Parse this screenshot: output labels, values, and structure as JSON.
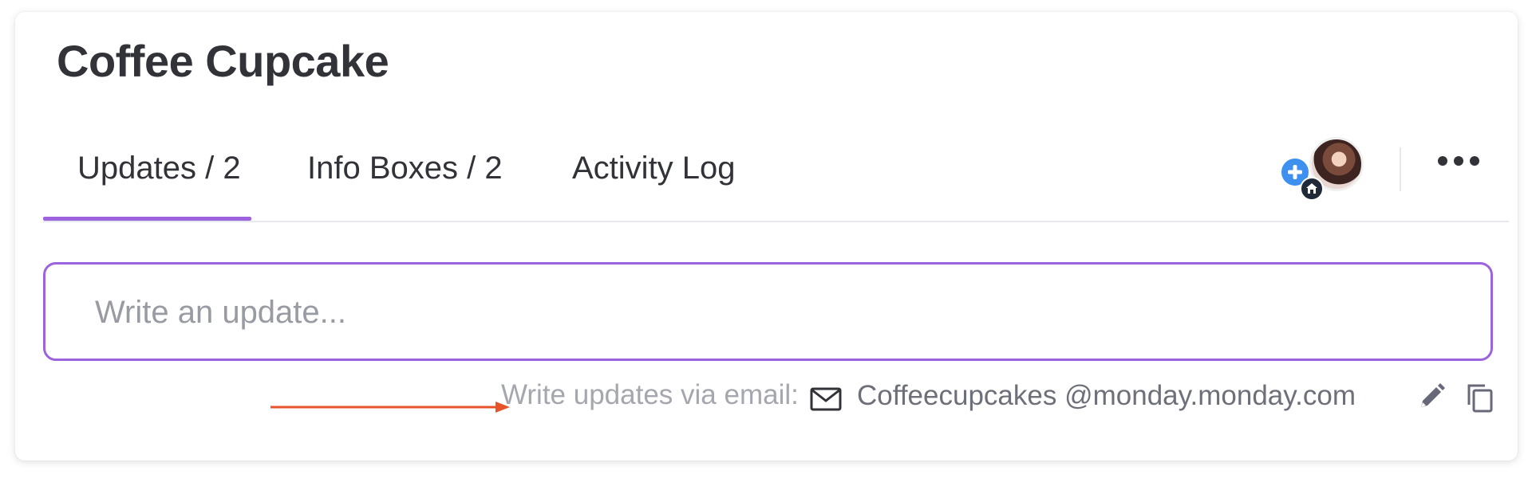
{
  "item": {
    "title": "Coffee Cupcake"
  },
  "tabs": [
    {
      "label": "Updates / 2",
      "active": true
    },
    {
      "label": "Info Boxes / 2",
      "active": false
    },
    {
      "label": "Activity Log",
      "active": false
    }
  ],
  "toolbar": {
    "subscriber_icon": "avatar",
    "add_subscriber_icon": "plus-icon",
    "home_badge_icon": "home-icon",
    "more_icon": "more-dots-icon"
  },
  "update": {
    "placeholder": "Write an update..."
  },
  "email": {
    "label": "Write updates via email:",
    "address": "Coffeecupcakes @monday.monday.com",
    "mail_icon": "envelope-icon",
    "edit_icon": "pencil-icon",
    "copy_icon": "copy-icon"
  },
  "colors": {
    "accent": "#9d62dd",
    "plus_button": "#3d8ff0",
    "arrow": "#e8542a"
  }
}
